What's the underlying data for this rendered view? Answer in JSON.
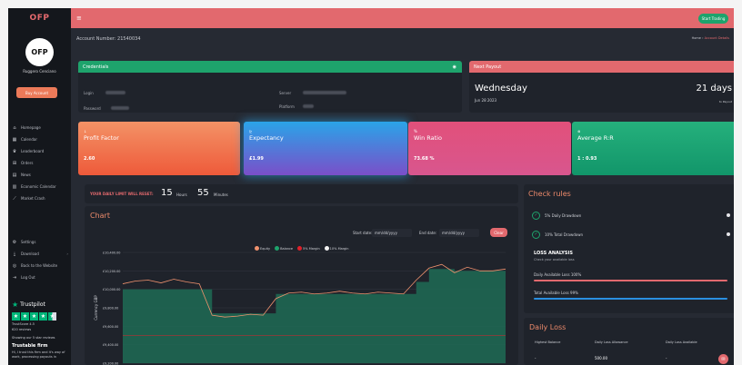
{
  "brand": "OFP",
  "sidebar": {
    "avatar_text": "OFP",
    "user_name": "Ruggero Cenciano",
    "buy_button": "Buy Account",
    "nav_main": [
      {
        "icon": "home-icon",
        "glyph": "⌂",
        "label": "Homepage"
      },
      {
        "icon": "calendar-icon",
        "glyph": "▦",
        "label": "Calendar"
      },
      {
        "icon": "trophy-icon",
        "glyph": "♛",
        "label": "Leaderboard"
      },
      {
        "icon": "cart-icon",
        "glyph": "⊞",
        "label": "Orders"
      },
      {
        "icon": "news-icon",
        "glyph": "▤",
        "label": "News"
      },
      {
        "icon": "economic-calendar-icon",
        "glyph": "▥",
        "label": "Economic Calendar"
      },
      {
        "icon": "chart-icon",
        "glyph": "⟋",
        "label": "Market Crash"
      }
    ],
    "nav_bottom": [
      {
        "icon": "settings-icon",
        "glyph": "⚙",
        "label": "Settings"
      },
      {
        "icon": "download-icon",
        "glyph": "⤓",
        "label": "Download",
        "chevron": "›"
      },
      {
        "icon": "globe-icon",
        "glyph": "◎",
        "label": "Back to the Website"
      },
      {
        "icon": "logout-icon",
        "glyph": "⇥",
        "label": "Log Out"
      }
    ],
    "trustpilot": {
      "title": "Trustpilot",
      "score": "TrustScore 4.5",
      "reviews": "620 reviews",
      "showing": "Showing our 5 star reviews",
      "firm_title": "Trustable firm",
      "quote": "Hi, I trust this firm and it's way of work, processing payouts in"
    }
  },
  "topbar": {
    "menu_glyph": "≡",
    "start_trading": "Start Trading"
  },
  "account_number": "Account Number: 21540034",
  "breadcrumb": {
    "home": "Home",
    "sep": "›",
    "current": "Account Details"
  },
  "credentials": {
    "title": "Credentials",
    "eye_glyph": "◉",
    "login_label": "Login",
    "password_label": "Password",
    "server_label": "Server",
    "platform_label": "Platform"
  },
  "payout": {
    "title": "Next Payout",
    "day": "Wednesday",
    "date": "Jun 28 2023",
    "days": "21 days",
    "sub": "to Payout"
  },
  "stats": [
    {
      "icon": "profit-factor-icon",
      "glyph": "↓",
      "label": "Profit Factor",
      "value": "2.60",
      "from": "#f39266",
      "to": "#ee5a3a"
    },
    {
      "icon": "expectancy-icon",
      "glyph": "⊵",
      "label": "Expectancy",
      "value": "£1.99",
      "from": "#2aa4e8",
      "to": "#7a4fc9"
    },
    {
      "icon": "win-ratio-icon",
      "glyph": "%",
      "label": "Win Ratio",
      "value": "73.68 %",
      "from": "#e2507a",
      "to": "#d8568e"
    },
    {
      "icon": "average-rr-icon",
      "glyph": "⊗",
      "label": "Average R:R",
      "value": "1 : 0.93",
      "from": "#25b07c",
      "to": "#12966a"
    }
  ],
  "daily_limit": {
    "label": "YOUR DAILY LIMIT WILL RESET:",
    "hours": "15",
    "hours_label": "Hours",
    "minutes": "55",
    "minutes_label": "Minutes"
  },
  "chart": {
    "title": "Chart",
    "start_label": "Start date:",
    "end_label": "End date:",
    "date_placeholder": "mm/dd/yyyy",
    "clear": "Clear",
    "ylabel": "Currency GBP",
    "legend": [
      {
        "name": "Equity",
        "color": "#f0926e"
      },
      {
        "name": "Balance",
        "color": "#1ea36c"
      },
      {
        "name": "5% Margin",
        "color": "#e0202a"
      },
      {
        "name": "10% Margin",
        "color": "#f2f2f2"
      }
    ]
  },
  "chart_data": {
    "type": "area",
    "y_ticks": [
      "£10,400.00",
      "£10,200.00",
      "£10,000.00",
      "£9,800.00",
      "£9,600.00",
      "£9,400.00",
      "£9,200.00"
    ],
    "ylim": [
      9200,
      10400
    ],
    "series": [
      {
        "name": "Equity",
        "values": [
          10060,
          10090,
          10100,
          10070,
          10110,
          10080,
          10060,
          9720,
          9700,
          9710,
          9730,
          9720,
          9900,
          9960,
          9970,
          9950,
          9960,
          9980,
          9960,
          9950,
          9970,
          9960,
          9950,
          10100,
          10230,
          10270,
          10180,
          10240,
          10200,
          10200,
          10220
        ]
      },
      {
        "name": "Balance",
        "values": [
          10000,
          10000,
          10000,
          10000,
          10000,
          10000,
          10000,
          9740,
          9740,
          9740,
          9740,
          9740,
          9950,
          9950,
          9950,
          9950,
          9950,
          9950,
          9950,
          9950,
          9950,
          9950,
          9950,
          10080,
          10220,
          10220,
          10200,
          10200,
          10200,
          10200,
          10220
        ]
      },
      {
        "name": "5% Margin",
        "values": [
          9500,
          9500,
          9500,
          9500,
          9500,
          9500,
          9500,
          9500,
          9500,
          9500,
          9500,
          9500,
          9500,
          9500,
          9500,
          9500,
          9500,
          9500,
          9500,
          9500,
          9500,
          9500,
          9500,
          9500,
          9500,
          9500,
          9500,
          9500,
          9500,
          9500,
          9500
        ]
      },
      {
        "name": "10% Margin",
        "values": [
          9000,
          9000,
          9000,
          9000,
          9000,
          9000,
          9000,
          9000,
          9000,
          9000,
          9000,
          9000,
          9000,
          9000,
          9000,
          9000,
          9000,
          9000,
          9000,
          9000,
          9000,
          9000,
          9000,
          9000,
          9000,
          9000,
          9000,
          9000,
          9000,
          9000,
          9000
        ]
      }
    ]
  },
  "rules": {
    "title": "Check rules",
    "items": [
      "5% Daily Drawdown",
      "10% Total Drawdown"
    ],
    "loss_title": "LOSS ANALYSIS",
    "loss_sub": "Check your available loss",
    "daily_available": "Daily Available Loss   100%",
    "total_available": "Total Available Loss   99%",
    "daily_bar_color": "#e2696e",
    "total_bar_color": "#2a8fe0"
  },
  "daily_loss": {
    "title": "Daily Loss",
    "headers": [
      "Highest Balance",
      "Daily Loss Allowance",
      "Daily Loss Available"
    ],
    "values": [
      "-",
      "500.00",
      "-"
    ]
  },
  "chat_glyph": "✉"
}
